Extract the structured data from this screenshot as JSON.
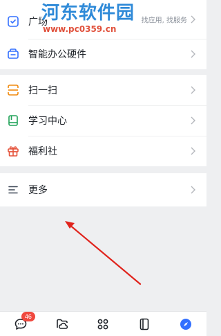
{
  "watermark": {
    "title": "河东软件园",
    "url": "www.pc0359.cn"
  },
  "menu": {
    "plaza": {
      "label": "广场",
      "hint": "找应用, 找服务"
    },
    "hardware": {
      "label": "智能办公硬件"
    },
    "scan": {
      "label": "扫一扫"
    },
    "learning": {
      "label": "学习中心"
    },
    "welfare": {
      "label": "福利社"
    },
    "more": {
      "label": "更多"
    }
  },
  "tabbar": {
    "messages_badge": "46",
    "tabs": [
      "chat-bubble-icon",
      "cloud-folder-icon",
      "apps-grid-icon",
      "contacts-book-icon",
      "compass-icon"
    ]
  },
  "colors": {
    "accent": "#3370ff",
    "badge": "#f0483e",
    "arrow": "#e0231c",
    "icon_orange": "#f18a0e",
    "icon_green": "#22a35a",
    "icon_red": "#e5533b"
  }
}
